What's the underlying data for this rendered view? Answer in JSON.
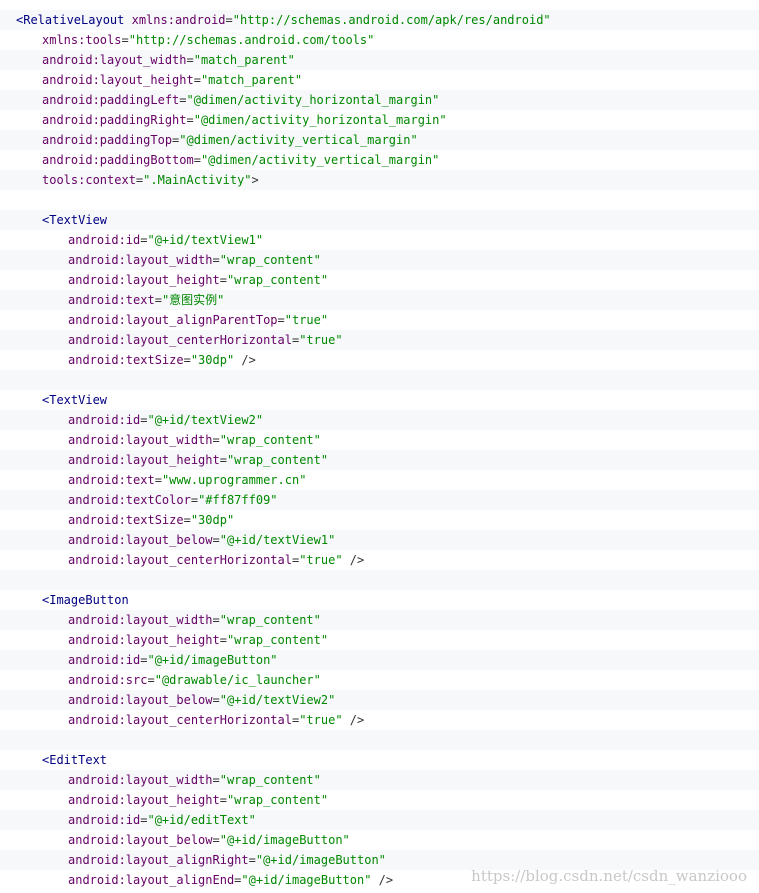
{
  "code_lines": [
    {
      "indent": 1,
      "tag": "<RelativeLayout",
      "attr": "xmlns:android",
      "value": "\"http://schemas.android.com/apk/res/android\"",
      "tail": ""
    },
    {
      "indent": 2,
      "tag": "",
      "attr": "xmlns:tools",
      "value": "\"http://schemas.android.com/tools\"",
      "tail": ""
    },
    {
      "indent": 2,
      "tag": "",
      "attr": "android:layout_width",
      "value": "\"match_parent\"",
      "tail": ""
    },
    {
      "indent": 2,
      "tag": "",
      "attr": "android:layout_height",
      "value": "\"match_parent\"",
      "tail": ""
    },
    {
      "indent": 2,
      "tag": "",
      "attr": "android:paddingLeft",
      "value": "\"@dimen/activity_horizontal_margin\"",
      "tail": ""
    },
    {
      "indent": 2,
      "tag": "",
      "attr": "android:paddingRight",
      "value": "\"@dimen/activity_horizontal_margin\"",
      "tail": ""
    },
    {
      "indent": 2,
      "tag": "",
      "attr": "android:paddingTop",
      "value": "\"@dimen/activity_vertical_margin\"",
      "tail": ""
    },
    {
      "indent": 2,
      "tag": "",
      "attr": "android:paddingBottom",
      "value": "\"@dimen/activity_vertical_margin\"",
      "tail": ""
    },
    {
      "indent": 2,
      "tag": "",
      "attr": "tools:context",
      "value": "\".MainActivity\"",
      "tail": ">"
    },
    {
      "indent": 0,
      "tag": "",
      "attr": "",
      "value": "",
      "tail": ""
    },
    {
      "indent": 2,
      "tag": "<TextView",
      "attr": "",
      "value": "",
      "tail": ""
    },
    {
      "indent": 3,
      "tag": "",
      "attr": "android:id",
      "value": "\"@+id/textView1\"",
      "tail": ""
    },
    {
      "indent": 3,
      "tag": "",
      "attr": "android:layout_width",
      "value": "\"wrap_content\"",
      "tail": ""
    },
    {
      "indent": 3,
      "tag": "",
      "attr": "android:layout_height",
      "value": "\"wrap_content\"",
      "tail": ""
    },
    {
      "indent": 3,
      "tag": "",
      "attr": "android:text",
      "value": "\"意图实例\"",
      "tail": ""
    },
    {
      "indent": 3,
      "tag": "",
      "attr": "android:layout_alignParentTop",
      "value": "\"true\"",
      "tail": ""
    },
    {
      "indent": 3,
      "tag": "",
      "attr": "android:layout_centerHorizontal",
      "value": "\"true\"",
      "tail": ""
    },
    {
      "indent": 3,
      "tag": "",
      "attr": "android:textSize",
      "value": "\"30dp\"",
      "tail": " />"
    },
    {
      "indent": 0,
      "tag": "",
      "attr": "",
      "value": "",
      "tail": ""
    },
    {
      "indent": 2,
      "tag": "<TextView",
      "attr": "",
      "value": "",
      "tail": ""
    },
    {
      "indent": 3,
      "tag": "",
      "attr": "android:id",
      "value": "\"@+id/textView2\"",
      "tail": ""
    },
    {
      "indent": 3,
      "tag": "",
      "attr": "android:layout_width",
      "value": "\"wrap_content\"",
      "tail": ""
    },
    {
      "indent": 3,
      "tag": "",
      "attr": "android:layout_height",
      "value": "\"wrap_content\"",
      "tail": ""
    },
    {
      "indent": 3,
      "tag": "",
      "attr": "android:text",
      "value": "\"www.uprogrammer.cn\"",
      "tail": ""
    },
    {
      "indent": 3,
      "tag": "",
      "attr": "android:textColor",
      "value": "\"#ff87ff09\"",
      "tail": ""
    },
    {
      "indent": 3,
      "tag": "",
      "attr": "android:textSize",
      "value": "\"30dp\"",
      "tail": ""
    },
    {
      "indent": 3,
      "tag": "",
      "attr": "android:layout_below",
      "value": "\"@+id/textView1\"",
      "tail": ""
    },
    {
      "indent": 3,
      "tag": "",
      "attr": "android:layout_centerHorizontal",
      "value": "\"true\"",
      "tail": " />"
    },
    {
      "indent": 0,
      "tag": "",
      "attr": "",
      "value": "",
      "tail": ""
    },
    {
      "indent": 2,
      "tag": "<ImageButton",
      "attr": "",
      "value": "",
      "tail": ""
    },
    {
      "indent": 3,
      "tag": "",
      "attr": "android:layout_width",
      "value": "\"wrap_content\"",
      "tail": ""
    },
    {
      "indent": 3,
      "tag": "",
      "attr": "android:layout_height",
      "value": "\"wrap_content\"",
      "tail": ""
    },
    {
      "indent": 3,
      "tag": "",
      "attr": "android:id",
      "value": "\"@+id/imageButton\"",
      "tail": ""
    },
    {
      "indent": 3,
      "tag": "",
      "attr": "android:src",
      "value": "\"@drawable/ic_launcher\"",
      "tail": ""
    },
    {
      "indent": 3,
      "tag": "",
      "attr": "android:layout_below",
      "value": "\"@+id/textView2\"",
      "tail": ""
    },
    {
      "indent": 3,
      "tag": "",
      "attr": "android:layout_centerHorizontal",
      "value": "\"true\"",
      "tail": " />"
    },
    {
      "indent": 0,
      "tag": "",
      "attr": "",
      "value": "",
      "tail": ""
    },
    {
      "indent": 2,
      "tag": "<EditText",
      "attr": "",
      "value": "",
      "tail": ""
    },
    {
      "indent": 3,
      "tag": "",
      "attr": "android:layout_width",
      "value": "\"wrap_content\"",
      "tail": ""
    },
    {
      "indent": 3,
      "tag": "",
      "attr": "android:layout_height",
      "value": "\"wrap_content\"",
      "tail": ""
    },
    {
      "indent": 3,
      "tag": "",
      "attr": "android:id",
      "value": "\"@+id/editText\"",
      "tail": ""
    },
    {
      "indent": 3,
      "tag": "",
      "attr": "android:layout_below",
      "value": "\"@+id/imageButton\"",
      "tail": ""
    },
    {
      "indent": 3,
      "tag": "",
      "attr": "android:layout_alignRight",
      "value": "\"@+id/imageButton\"",
      "tail": ""
    },
    {
      "indent": 3,
      "tag": "",
      "attr": "android:layout_alignEnd",
      "value": "\"@+id/imageButton\"",
      "tail": " />"
    }
  ],
  "watermark": "https://blog.csdn.net/csdn_wanziooo",
  "colors": {
    "tag": "#000080",
    "attribute": "#660066",
    "value": "#008800",
    "stripe": "#f6f8fa"
  }
}
